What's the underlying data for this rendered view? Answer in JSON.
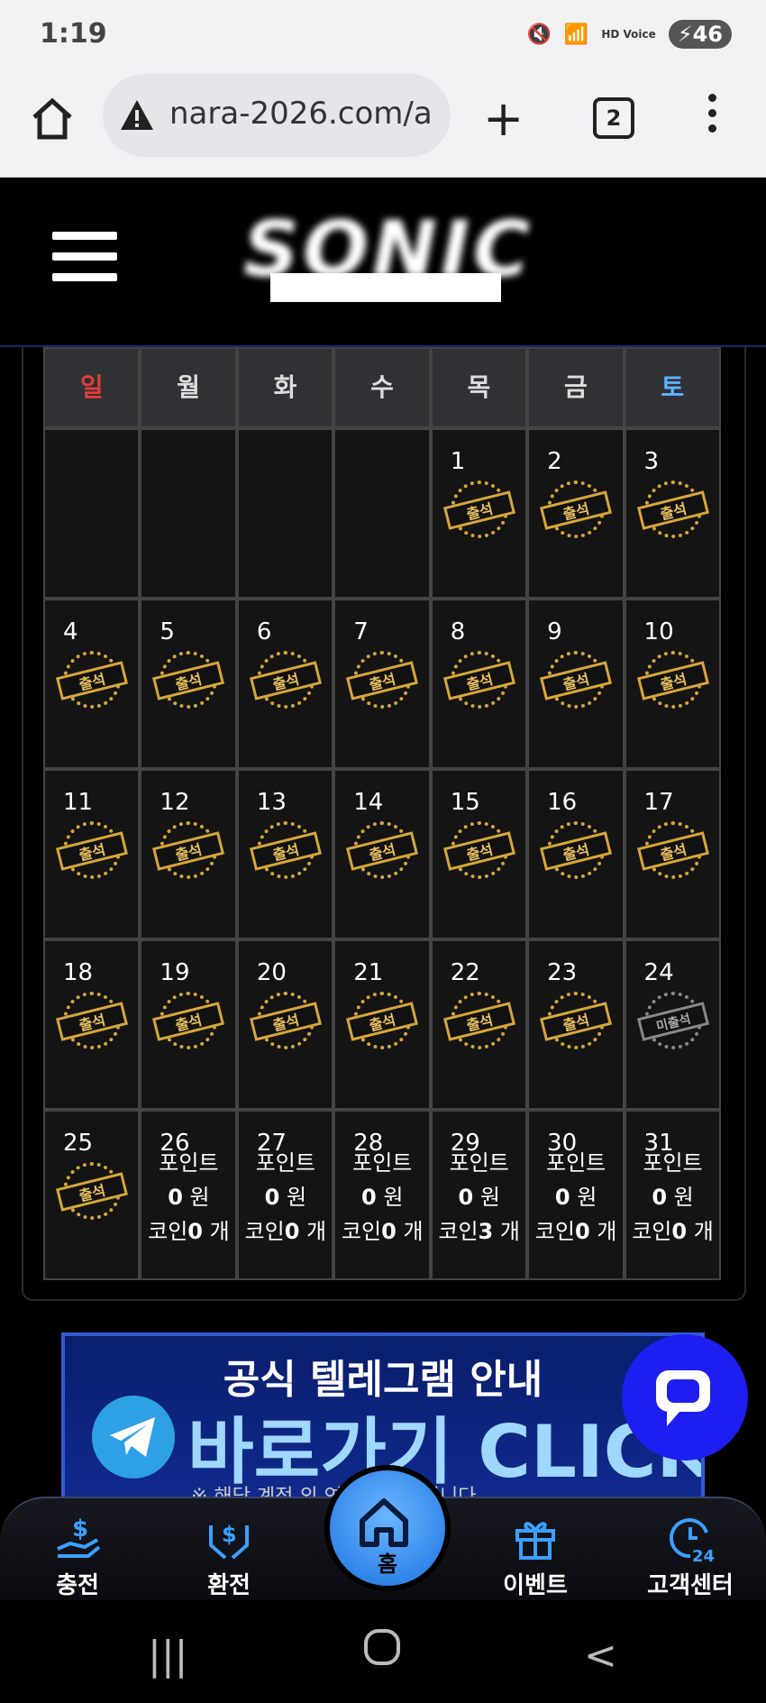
{
  "status": {
    "time": "1:19",
    "battery": "46",
    "network": "HD Voice"
  },
  "browser": {
    "url": "nara-2026.com/a",
    "tab_count": "2"
  },
  "site": {
    "logo_text": "SONIC"
  },
  "calendar": {
    "weekdays": [
      "일",
      "월",
      "화",
      "수",
      "목",
      "금",
      "토"
    ],
    "stamp_attended": "출석",
    "stamp_missed": "미출석",
    "weeks": [
      [
        null,
        null,
        null,
        null,
        {
          "d": "1",
          "s": "a"
        },
        {
          "d": "2",
          "s": "a"
        },
        {
          "d": "3",
          "s": "a"
        }
      ],
      [
        {
          "d": "4",
          "s": "a"
        },
        {
          "d": "5",
          "s": "a"
        },
        {
          "d": "6",
          "s": "a"
        },
        {
          "d": "7",
          "s": "a"
        },
        {
          "d": "8",
          "s": "a"
        },
        {
          "d": "9",
          "s": "a"
        },
        {
          "d": "10",
          "s": "a"
        }
      ],
      [
        {
          "d": "11",
          "s": "a"
        },
        {
          "d": "12",
          "s": "a"
        },
        {
          "d": "13",
          "s": "a"
        },
        {
          "d": "14",
          "s": "a"
        },
        {
          "d": "15",
          "s": "a"
        },
        {
          "d": "16",
          "s": "a"
        },
        {
          "d": "17",
          "s": "a"
        }
      ],
      [
        {
          "d": "18",
          "s": "a"
        },
        {
          "d": "19",
          "s": "a"
        },
        {
          "d": "20",
          "s": "a"
        },
        {
          "d": "21",
          "s": "a"
        },
        {
          "d": "22",
          "s": "a"
        },
        {
          "d": "23",
          "s": "a"
        },
        {
          "d": "24",
          "s": "m"
        }
      ],
      [
        {
          "d": "25",
          "s": "a"
        },
        {
          "d": "26",
          "s": "p",
          "coin": "0"
        },
        {
          "d": "27",
          "s": "p",
          "coin": "0"
        },
        {
          "d": "28",
          "s": "p",
          "coin": "0"
        },
        {
          "d": "29",
          "s": "p",
          "coin": "3"
        },
        {
          "d": "30",
          "s": "p",
          "coin": "0"
        },
        {
          "d": "31",
          "s": "p",
          "coin": "0"
        }
      ]
    ],
    "point_label": "포인트",
    "point_value": "0",
    "point_unit": "원",
    "coin_label": "코인",
    "coin_unit": "개"
  },
  "banner": {
    "title": "공식 텔레그램 안내",
    "click_text": "바로가기 CLICK",
    "subtext": "※ 해당 계정 외 연락은 사칭입니다"
  },
  "nav": {
    "charge": "충전",
    "exchange": "환전",
    "home": "홈",
    "event": "이벤트",
    "support": "고객센터"
  }
}
